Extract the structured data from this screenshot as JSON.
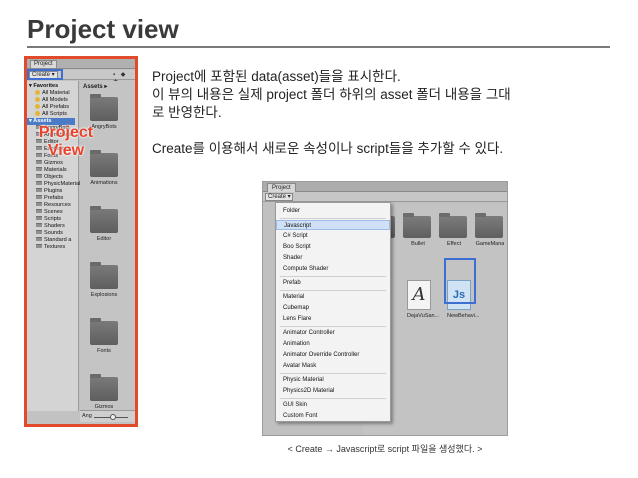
{
  "slide": {
    "title": "Project view"
  },
  "left_panel": {
    "tab_label": "Project",
    "create_label": "Create ▾",
    "tool_icons": "▪ ◆ ★",
    "assets_header": "Assets ▸",
    "tree": [
      {
        "label": "▾ Favorites",
        "kind": "header"
      },
      {
        "label": "All Material",
        "kind": "fav"
      },
      {
        "label": "All Models",
        "kind": "fav"
      },
      {
        "label": "All Prefabs",
        "kind": "fav"
      },
      {
        "label": "All Scripts",
        "kind": "fav"
      },
      {
        "label": "▾ Assets",
        "kind": "selected"
      },
      {
        "label": "AngryBots",
        "kind": "folder"
      },
      {
        "label": "Animations",
        "kind": "folder"
      },
      {
        "label": "Editor",
        "kind": "folder"
      },
      {
        "label": "Explosions",
        "kind": "folder"
      },
      {
        "label": "Fonts",
        "kind": "folder"
      },
      {
        "label": "Gizmos",
        "kind": "folder"
      },
      {
        "label": "Materials",
        "kind": "folder"
      },
      {
        "label": "Objects",
        "kind": "folder"
      },
      {
        "label": "PhysicMaterials",
        "kind": "folder"
      },
      {
        "label": "Plugins",
        "kind": "folder"
      },
      {
        "label": "Prefabs",
        "kind": "folder"
      },
      {
        "label": "Resources",
        "kind": "folder"
      },
      {
        "label": "Scenes",
        "kind": "folder"
      },
      {
        "label": "Scripts",
        "kind": "folder"
      },
      {
        "label": "Shaders",
        "kind": "folder"
      },
      {
        "label": "Sounds",
        "kind": "folder"
      },
      {
        "label": "Standard a",
        "kind": "folder"
      },
      {
        "label": "Textures",
        "kind": "folder"
      }
    ],
    "assets": [
      "AngryBots",
      "Animations",
      "Editor",
      "Explosions",
      "Fonts",
      "Gizmos"
    ],
    "zoom_label": "Ang",
    "overlay_line1": "Project",
    "overlay_line2": "View"
  },
  "description": {
    "line1": "Project에 포함된 data(asset)들을 표시한다.",
    "line2": "이 뷰의 내용은 실제 project 폴더 하위의 asset 폴더 내용을 그대",
    "line3": "로 반영한다.",
    "line4": "Create를 이용해서 새로운 속성이나 script들을 추가할 수 있다."
  },
  "menu_shot": {
    "tab_label": "Project",
    "create_label": "Create ▾",
    "items": [
      "Folder",
      "Javascript",
      "C# Script",
      "Boo Script",
      "Shader",
      "Compute Shader",
      "Prefab",
      "Material",
      "Cubemap",
      "Lens Flare",
      "Animator Controller",
      "Animation",
      "Animator Override Controller",
      "Avatar Mask",
      "Physic Material",
      "Physics2D Material",
      "GUI Skin",
      "Custom Font"
    ],
    "hover_item": "Javascript",
    "asset_folders": [
      "",
      "Bullet",
      "Effect",
      "GameMana"
    ],
    "asset_files": {
      "partial_label": "s",
      "font_label": "DejaVuSan...",
      "font_glyph": "A",
      "script_label": "NewBehavi...",
      "script_glyph": "Js"
    },
    "caption": "< Create → Javascript로 script 파일을 생성했다. >"
  },
  "colors": {
    "panel_border": "#e24a2c",
    "highlight_blue": "#3c6fd1",
    "overlay_text": "#e8432c"
  }
}
